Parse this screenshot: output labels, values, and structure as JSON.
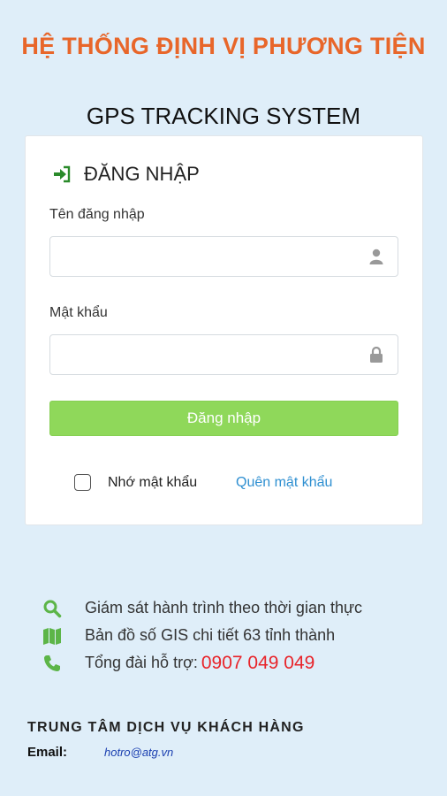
{
  "header": {
    "title_vn": "HỆ THỐNG ĐỊNH VỊ PHƯƠNG TIỆN",
    "title_en": "GPS TRACKING SYSTEM"
  },
  "login": {
    "heading": "ĐĂNG NHẬP",
    "username_label": "Tên đăng nhập",
    "username_value": "",
    "password_label": "Mật khẩu",
    "password_value": "",
    "submit_label": "Đăng nhập",
    "remember_label": "Nhớ mật khẩu",
    "remember_checked": false,
    "forgot_label": "Quên mật khẩu"
  },
  "features": [
    {
      "icon": "search-icon",
      "text": "Giám sát hành trình theo thời gian thực"
    },
    {
      "icon": "map-icon",
      "text": "Bản đồ số GIS chi tiết 63 tỉnh thành"
    },
    {
      "icon": "phone-icon",
      "text": "Tổng đài hỗ trợ:",
      "hotline": "0907 049 049"
    }
  ],
  "footer": {
    "center_title": "TRUNG TÂM DỊCH VỤ KHÁCH HÀNG",
    "email_label": "Email:",
    "email_value": "hotro@atg.vn"
  },
  "colors": {
    "background": "#dfeef9",
    "title_accent": "#e8662a",
    "button": "#8fd85a",
    "icon_green": "#5cb548",
    "link": "#2e8fd1",
    "hotline": "#e8242a",
    "email": "#1a3fb0"
  }
}
